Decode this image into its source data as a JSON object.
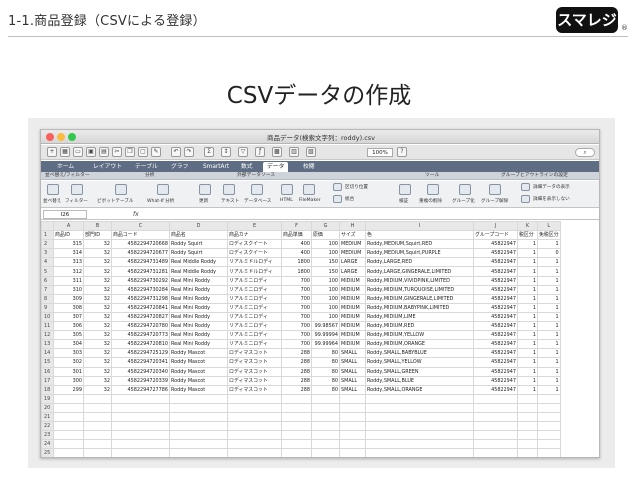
{
  "slide": {
    "title": "1-1.商品登録（CSVによる登録）",
    "logo_text": "スマレジ",
    "logo_mark": "®",
    "heading": "CSVデータの作成"
  },
  "window": {
    "title": "商品データ(検索文字列：roddy).csv",
    "zoom": "100%"
  },
  "ribbon": {
    "tabs": [
      "ホーム",
      "レイアウト",
      "テーブル",
      "グラフ",
      "SmartArt",
      "数式",
      "データ",
      "校閲"
    ],
    "active_tab": "データ",
    "groups": [
      "並べ替え/フィルター",
      "分析",
      "外部データソース",
      "ツール",
      "グループとアウトラインの設定"
    ],
    "buttons": [
      "並べ替え",
      "フィルター",
      "ピボットテーブル",
      "What-If 分析",
      "更新",
      "テキスト",
      "データベース",
      "HTML",
      "FileMaker",
      "区切り位置",
      "統合",
      "検証",
      "重複の削除",
      "グループ化",
      "グループ解除",
      "詳細データの表示",
      "詳細を表示しない"
    ]
  },
  "formula_bar": {
    "cell": "I26",
    "fx": "fx"
  },
  "columns": [
    "A",
    "B",
    "C",
    "D",
    "E",
    "F",
    "G",
    "H",
    "I",
    "J",
    "K",
    "L"
  ],
  "header_row": [
    "商品ID",
    "部門ID",
    "商品コード",
    "商品名",
    "商品カナ",
    "商品単価",
    "原価",
    "サイズ",
    "色",
    "グループコード",
    "税区分",
    "免税区分"
  ],
  "rows": [
    [
      "315",
      "32",
      "4582294720668",
      "Roddy Squirt",
      "ロディスクイート",
      "400",
      "100",
      "MEDIUM",
      "Roddy,MEDIUM,Squirt,RED",
      "45822947",
      "1",
      "1"
    ],
    [
      "314",
      "32",
      "4582294720677",
      "Roddy Squirt",
      "ロディスクイート",
      "400",
      "100",
      "MEDIUM",
      "Roddy,MEDIUM,Squirt,PURPLE",
      "45822947",
      "1",
      "0"
    ],
    [
      "313",
      "32",
      "4582294731489",
      "Real Middle Roddy",
      "リアルミドルロディ",
      "1800",
      "150",
      "LARGE",
      "Roddy,LARGE,RED",
      "45822947",
      "1",
      "1"
    ],
    [
      "312",
      "32",
      "4582294731281",
      "Real Middle Roddy",
      "リアルミドルロディ",
      "1800",
      "150",
      "LARGE",
      "Roddy,LARGE,GINGERALE,LIMITED",
      "45822947",
      "1",
      "1"
    ],
    [
      "311",
      "32",
      "4582294730292",
      "Real Mini Roddy",
      "リアルミニロディ",
      "700",
      "100",
      "MIDIUM",
      "Roddy,MIDIUM,VIVIDPINK,LIMITED",
      "45822947",
      "1",
      "1"
    ],
    [
      "310",
      "32",
      "4582294730284",
      "Real Mini Roddy",
      "リアルミニロディ",
      "700",
      "100",
      "MIDIUM",
      "Roddy,MIDIUM,TURQUOISE,LIMITED",
      "45822947",
      "1",
      "1"
    ],
    [
      "309",
      "32",
      "4582294731298",
      "Real Mini Roddy",
      "リアルミニロディ",
      "700",
      "100",
      "MIDIUM",
      "Roddy,MIDIUM,GINGERALE,LIMITED",
      "45822947",
      "1",
      "1"
    ],
    [
      "308",
      "32",
      "4582294720841",
      "Real Mini Roddy",
      "リアルミニロディ",
      "700",
      "100",
      "MIDIUM",
      "Roddy,MIDIUM,BABYPINK,LIMITED",
      "45822947",
      "1",
      "1"
    ],
    [
      "307",
      "32",
      "4582294720827",
      "Real Mini Roddy",
      "リアルミニロディ",
      "700",
      "100",
      "MIDIUM",
      "Roddy,MIDIUM,LIME",
      "45822947",
      "1",
      "1"
    ],
    [
      "306",
      "32",
      "4582294720780",
      "Real Mini Roddy",
      "リアルミニロディ",
      "700",
      "99.98567",
      "MIDIUM",
      "Roddy,MIDIUM,RED",
      "45822947",
      "1",
      "1"
    ],
    [
      "305",
      "32",
      "4582294720773",
      "Real Mini Roddy",
      "リアルミニロディ",
      "700",
      "99.99994",
      "MIDIUM",
      "Roddy,MIDIUM,YELLOW",
      "45822947",
      "1",
      "1"
    ],
    [
      "304",
      "32",
      "4582294720810",
      "Real Mini Roddy",
      "リアルミニロディ",
      "700",
      "99.99964",
      "MIDIUM",
      "Roddy,MIDIUM,ORANGE",
      "45822947",
      "1",
      "1"
    ],
    [
      "303",
      "32",
      "4582294725129",
      "Roddy Mascot",
      "ロディマスコット",
      "288",
      "80",
      "SMALL",
      "Roddy,SMALL,BABYBLUE",
      "45822947",
      "1",
      "1"
    ],
    [
      "302",
      "32",
      "4582294720341",
      "Roddy Mascot",
      "ロディマスコット",
      "288",
      "80",
      "SMALL",
      "Roddy,SMALL,YELLOW",
      "45822947",
      "1",
      "1"
    ],
    [
      "301",
      "32",
      "4582294720340",
      "Roddy Mascot",
      "ロディマスコット",
      "288",
      "80",
      "SMALL",
      "Roddy,SMALL,GREEN",
      "45822947",
      "1",
      "1"
    ],
    [
      "300",
      "32",
      "4582294720339",
      "Roddy Mascot",
      "ロディマスコット",
      "288",
      "80",
      "SMALL",
      "Roddy,SMALL,BLUE",
      "45822947",
      "1",
      "1"
    ],
    [
      "299",
      "32",
      "4582294727786",
      "Roddy Mascot",
      "ロディマスコット",
      "288",
      "80",
      "SMALL",
      "Roddy,SMALL,ORANGE",
      "45822947",
      "1",
      "1"
    ]
  ],
  "row_numbers": [
    "1",
    "2",
    "3",
    "4",
    "5",
    "6",
    "7",
    "8",
    "9",
    "10",
    "11",
    "12",
    "13",
    "14",
    "15",
    "16",
    "17",
    "18",
    "19",
    "20",
    "21",
    "22",
    "23",
    "24",
    "25"
  ]
}
